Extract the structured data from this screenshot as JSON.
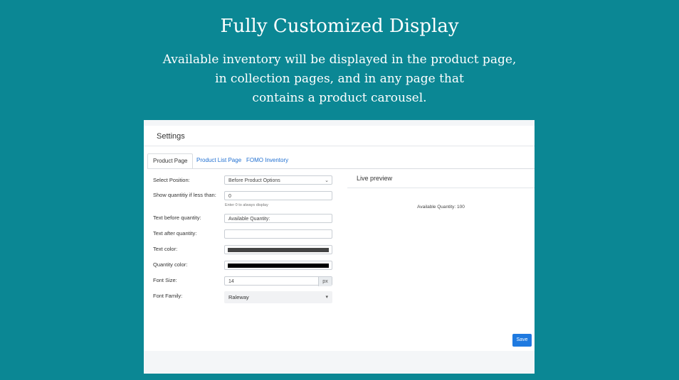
{
  "hero": {
    "title": "Fully Customized Display",
    "lines": [
      "Available inventory will be displayed in the product page,",
      "in collection pages, and in any page that",
      "contains a product carousel."
    ]
  },
  "settings": {
    "title": "Settings",
    "tabs": [
      "Product Page",
      "Product List Page",
      "FOMO Inventory"
    ],
    "fields": {
      "position_label": "Select Position:",
      "position_value": "Before Product Options",
      "threshold_label": "Show quantitiy if less than:",
      "threshold_value": "0",
      "threshold_hint": "Enter 0 to always display",
      "before_label": "Text before quantity:",
      "before_value": "Available Quantity:",
      "after_label": "Text after quantity:",
      "after_value": "",
      "text_color_label": "Text color:",
      "text_color": "#444444",
      "qty_color_label": "Quantity color:",
      "qty_color": "#000000",
      "font_size_label": "Font Size:",
      "font_size_value": "14",
      "font_size_unit": "px",
      "font_family_label": "Font Family:",
      "font_family_value": "Raleway"
    },
    "preview": {
      "title": "Live preview",
      "text": "Available Quantity: 100"
    },
    "save_label": "Save"
  },
  "colors": {
    "background": "#0b8794",
    "accent": "#1f7ae0"
  }
}
